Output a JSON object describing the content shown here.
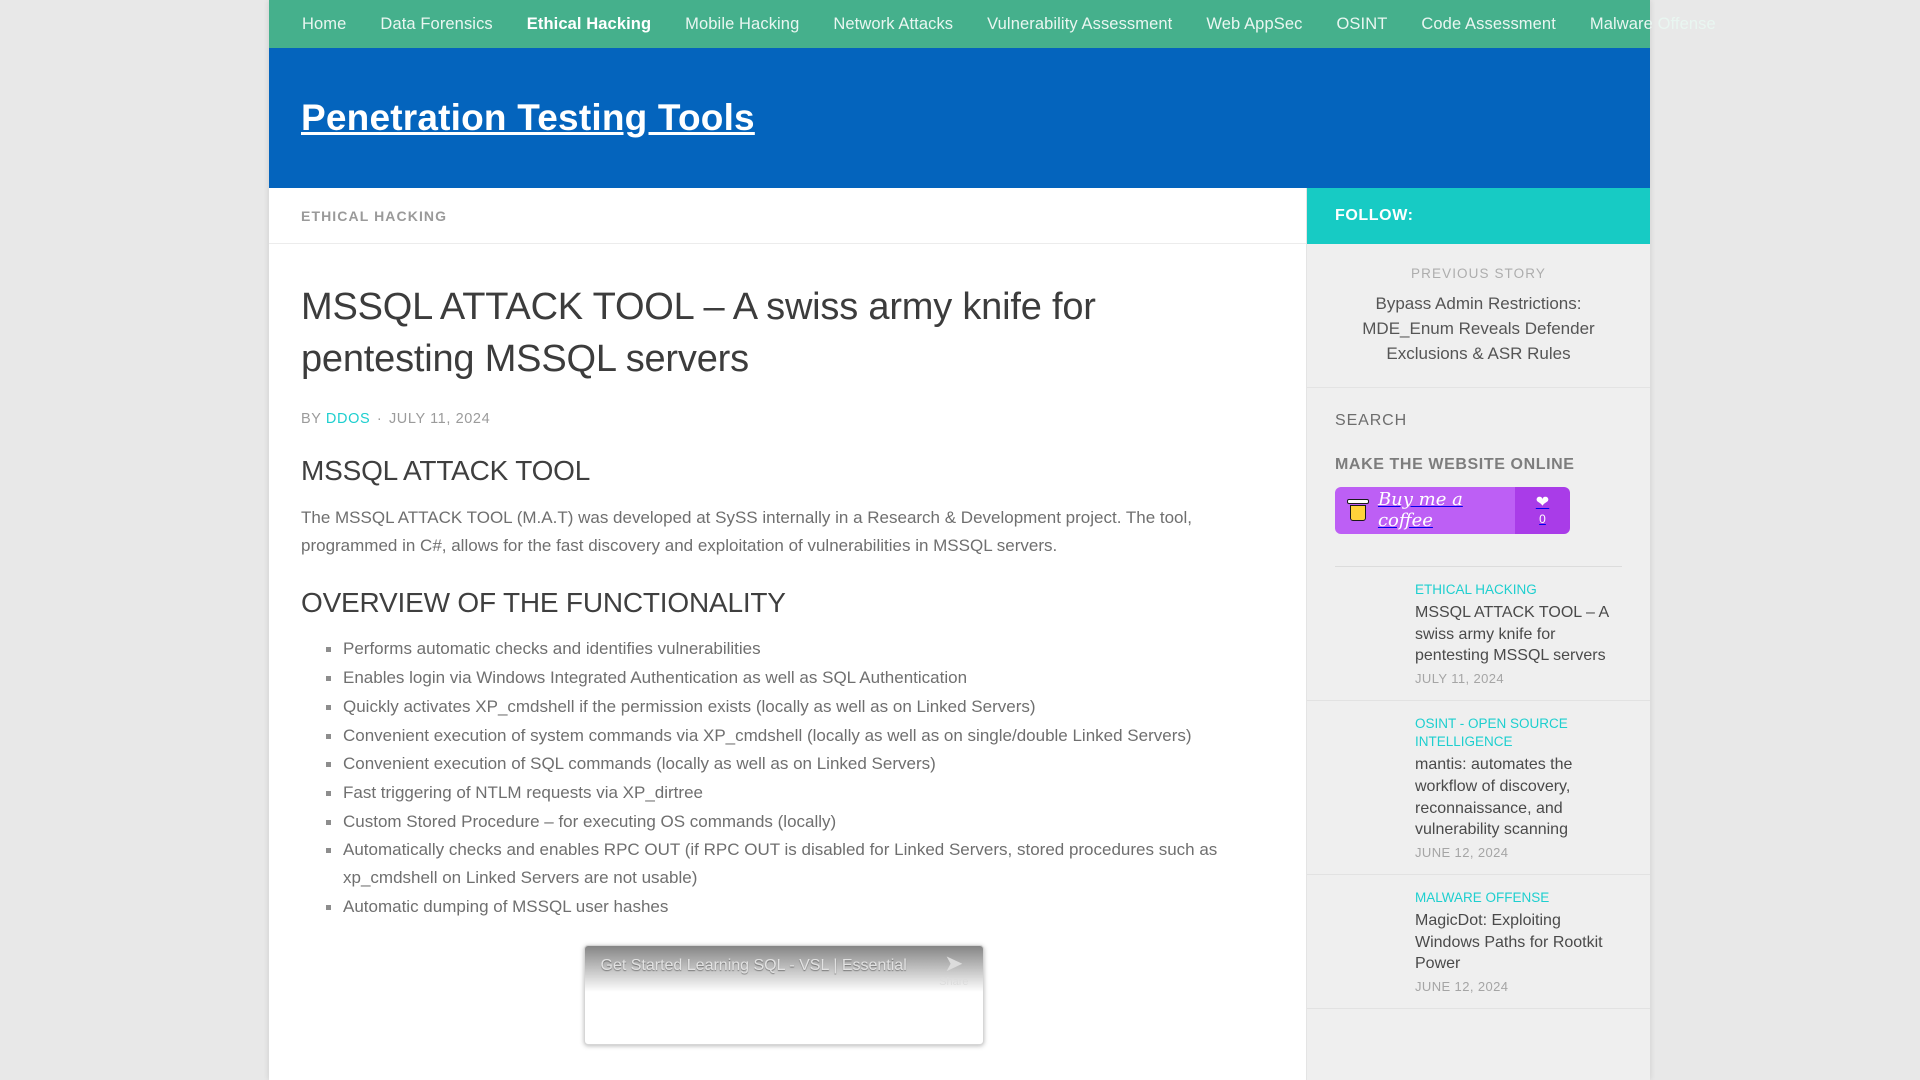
{
  "nav": {
    "items": [
      {
        "label": "Home",
        "active": false
      },
      {
        "label": "Data Forensics",
        "active": false
      },
      {
        "label": "Ethical Hacking",
        "active": true
      },
      {
        "label": "Mobile Hacking",
        "active": false
      },
      {
        "label": "Network Attacks",
        "active": false
      },
      {
        "label": "Vulnerability Assessment",
        "active": false
      },
      {
        "label": "Web AppSec",
        "active": false
      },
      {
        "label": "OSINT",
        "active": false
      },
      {
        "label": "Code Assessment",
        "active": false
      },
      {
        "label": "Malware Offense",
        "active": false
      }
    ]
  },
  "masthead": {
    "site_title": "Penetration Testing Tools",
    "background_color": "#0464bd"
  },
  "breadcrumb": {
    "category": "ETHICAL HACKING"
  },
  "article": {
    "title": "MSSQL ATTACK TOOL – A swiss army knife for pentesting MSSQL servers",
    "by_label": "BY",
    "author": "DDOS",
    "separator": "·",
    "date": "JULY 11, 2024",
    "heading_1": "MSSQL ATTACK TOOL",
    "paragraph_1": "The MSSQL ATTACK TOOL (M.A.T) was developed at SySS internally in a Research & Development project. The tool, programmed in C#, allows for the fast discovery and exploitation of vulnerabilities in MSSQL servers.",
    "heading_2": "OVERVIEW OF THE FUNCTIONALITY",
    "features": [
      "Performs automatic checks and identifies vulnerabilities",
      "Enables login via Windows Integrated Authentication as well as SQL Authentication",
      "Quickly activates XP_cmdshell if the permission exists (locally as well as on Linked Servers)",
      "Convenient execution of system commands via XP_cmdshell (locally as well as on single/double Linked Servers)",
      "Convenient execution of SQL commands (locally as well as on Linked Servers)",
      "Fast triggering of NTLM requests via XP_dirtree",
      "Custom Stored Procedure – for executing OS commands (locally)",
      "Automatically checks and enables RPC OUT (if RPC OUT is disabled for Linked Servers, stored procedures such as xp_cmdshell on Linked Servers are not usable)",
      "Automatic dumping of MSSQL user hashes"
    ]
  },
  "video": {
    "title": "Get Started Learning SQL - VSL | Essential ...",
    "share_label": "Share"
  },
  "sidebar": {
    "follow_title": "FOLLOW:",
    "follow_color": "#17cbc4",
    "previous": {
      "label": "PREVIOUS STORY",
      "title": "Bypass Admin Restrictions: MDE_Enum Reveals Defender Exclusions & ASR Rules"
    },
    "search": {
      "title": "SEARCH",
      "placeholder": ""
    },
    "support": {
      "title": "MAKE THE WEBSITE ONLINE",
      "button_label": "Buy me a coffee",
      "count": "0",
      "button_color": "#bd5ff5"
    },
    "recent_posts": [
      {
        "category": "ETHICAL HACKING",
        "title": "MSSQL ATTACK TOOL – A swiss army knife for pentesting MSSQL servers",
        "date": "JULY 11, 2024"
      },
      {
        "category": "OSINT - OPEN SOURCE INTELLIGENCE",
        "title": "mantis: automates the workflow of discovery, reconnaissance, and vulnerability scanning",
        "date": "JUNE 12, 2024"
      },
      {
        "category": "MALWARE OFFENSE",
        "title": "MagicDot: Exploiting Windows Paths for Rootkit Power",
        "date": "JUNE 12, 2024"
      }
    ]
  }
}
